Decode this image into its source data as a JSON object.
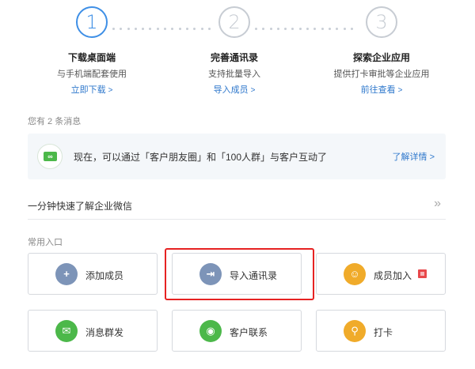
{
  "colors": {
    "accent": "#3e8fe6",
    "link": "#2f78cc",
    "highlight": "#e62222"
  },
  "steps": [
    {
      "number": "1",
      "title": "下载桌面端",
      "desc": "与手机端配套使用",
      "link": "立即下载",
      "active": true
    },
    {
      "number": "2",
      "title": "完善通讯录",
      "desc": "支持批量导入",
      "link": "导入成员",
      "active": false
    },
    {
      "number": "3",
      "title": "探索企业应用",
      "desc": "提供打卡审批等企业应用",
      "link": "前往查看",
      "active": false
    }
  ],
  "message_count": "您有 2 条消息",
  "notice": {
    "icon": "infinity-icon",
    "icon_glyph": "∞",
    "text": "现在，可以通过「客户朋友圈」和「100人群」与客户互动了",
    "link": "了解详情"
  },
  "quick_intro": {
    "text": "一分钟快速了解企业微信",
    "arrow": "»"
  },
  "common_label": "常用入口",
  "tiles": [
    {
      "label": "添加成员",
      "icon": "add-user-icon",
      "glyph": "+",
      "color": "#7d94b8"
    },
    {
      "label": "导入通讯录",
      "icon": "import-icon",
      "glyph": "⇥",
      "color": "#7d94b8"
    },
    {
      "label": "成员加入",
      "icon": "members-icon",
      "glyph": "☺",
      "color": "#f0ab2a"
    },
    {
      "label": "消息群发",
      "icon": "broadcast-icon",
      "glyph": "✉",
      "color": "#4cb84a"
    },
    {
      "label": "客户联系",
      "icon": "wechat-icon",
      "glyph": "◉",
      "color": "#4cb84a"
    },
    {
      "label": "打卡",
      "icon": "location-pin-icon",
      "glyph": "⚲",
      "color": "#f0ab2a"
    }
  ]
}
